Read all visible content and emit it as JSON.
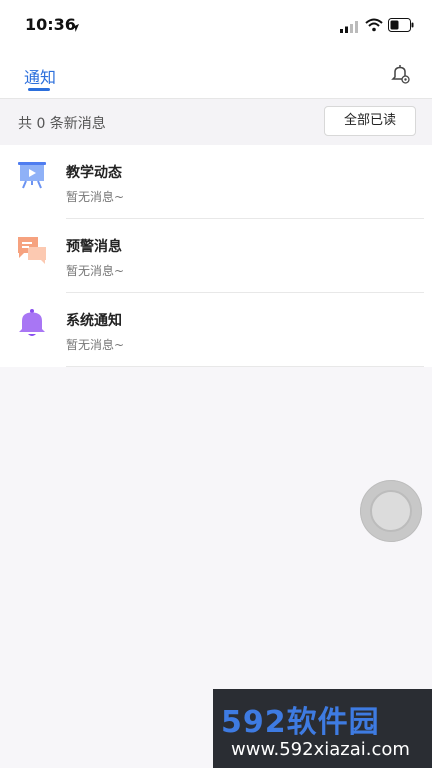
{
  "status_bar": {
    "time": "10:36"
  },
  "header": {
    "tab_label": "通知"
  },
  "summary": {
    "text": "共 0 条新消息",
    "mark_all_read_label": "全部已读"
  },
  "items": [
    {
      "title": "教学动态",
      "subtitle": "暂无消息~",
      "icon": "presentation-board-icon",
      "color": "#6b93f2"
    },
    {
      "title": "预警消息",
      "subtitle": "暂无消息~",
      "icon": "chat-bubbles-icon",
      "color": "#f08a5d"
    },
    {
      "title": "系统通知",
      "subtitle": "暂无消息~",
      "icon": "bell-icon",
      "color": "#9a5cf0"
    }
  ],
  "watermark": {
    "brand": "592软件园",
    "url": "www.592xiazai.com"
  },
  "colors": {
    "accent": "#2c6fdc",
    "background": "#f7f6f9"
  }
}
